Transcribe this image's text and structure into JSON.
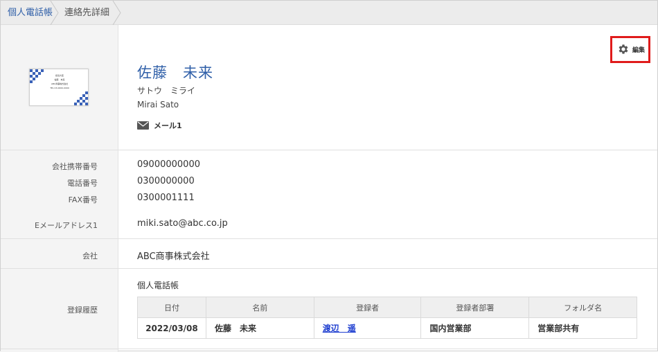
{
  "breadcrumb": {
    "items": [
      "個人電話帳",
      "連絡先詳細"
    ]
  },
  "contact": {
    "name_kanji": "佐藤　未来",
    "name_kana": "サトウ　ミライ",
    "name_roman": "Mirai Sato",
    "mail_label": "メール1"
  },
  "business_card": {
    "lines": [
      "担当大臣",
      "佐藤　未来",
      "ABC商事株式会社",
      "TEL 03-0000-0000"
    ]
  },
  "edit_button": {
    "label": "編集",
    "icon": "gear-icon"
  },
  "fields": {
    "mobile": {
      "label": "会社携帯番号",
      "value": "09000000000"
    },
    "phone": {
      "label": "電話番号",
      "value": "0300000000"
    },
    "fax": {
      "label": "FAX番号",
      "value": "0300001111"
    },
    "email": {
      "label": "Eメールアドレス1",
      "value": "miki.sato@abc.co.jp"
    },
    "company": {
      "label": "会社",
      "value": "ABC商事株式会社"
    }
  },
  "history": {
    "label": "登録履歴",
    "section_title": "個人電話帳",
    "columns": [
      "日付",
      "名前",
      "登録者",
      "登録者部署",
      "フォルダ名"
    ],
    "rows": [
      [
        "2022/03/08",
        "佐藤　未来",
        "渡辺　遥",
        "国内営業部",
        "営業部共有"
      ]
    ]
  },
  "colors": {
    "accent": "#2f5fa8",
    "highlight_border": "#e01b1b",
    "link": "#1f3fd0"
  }
}
